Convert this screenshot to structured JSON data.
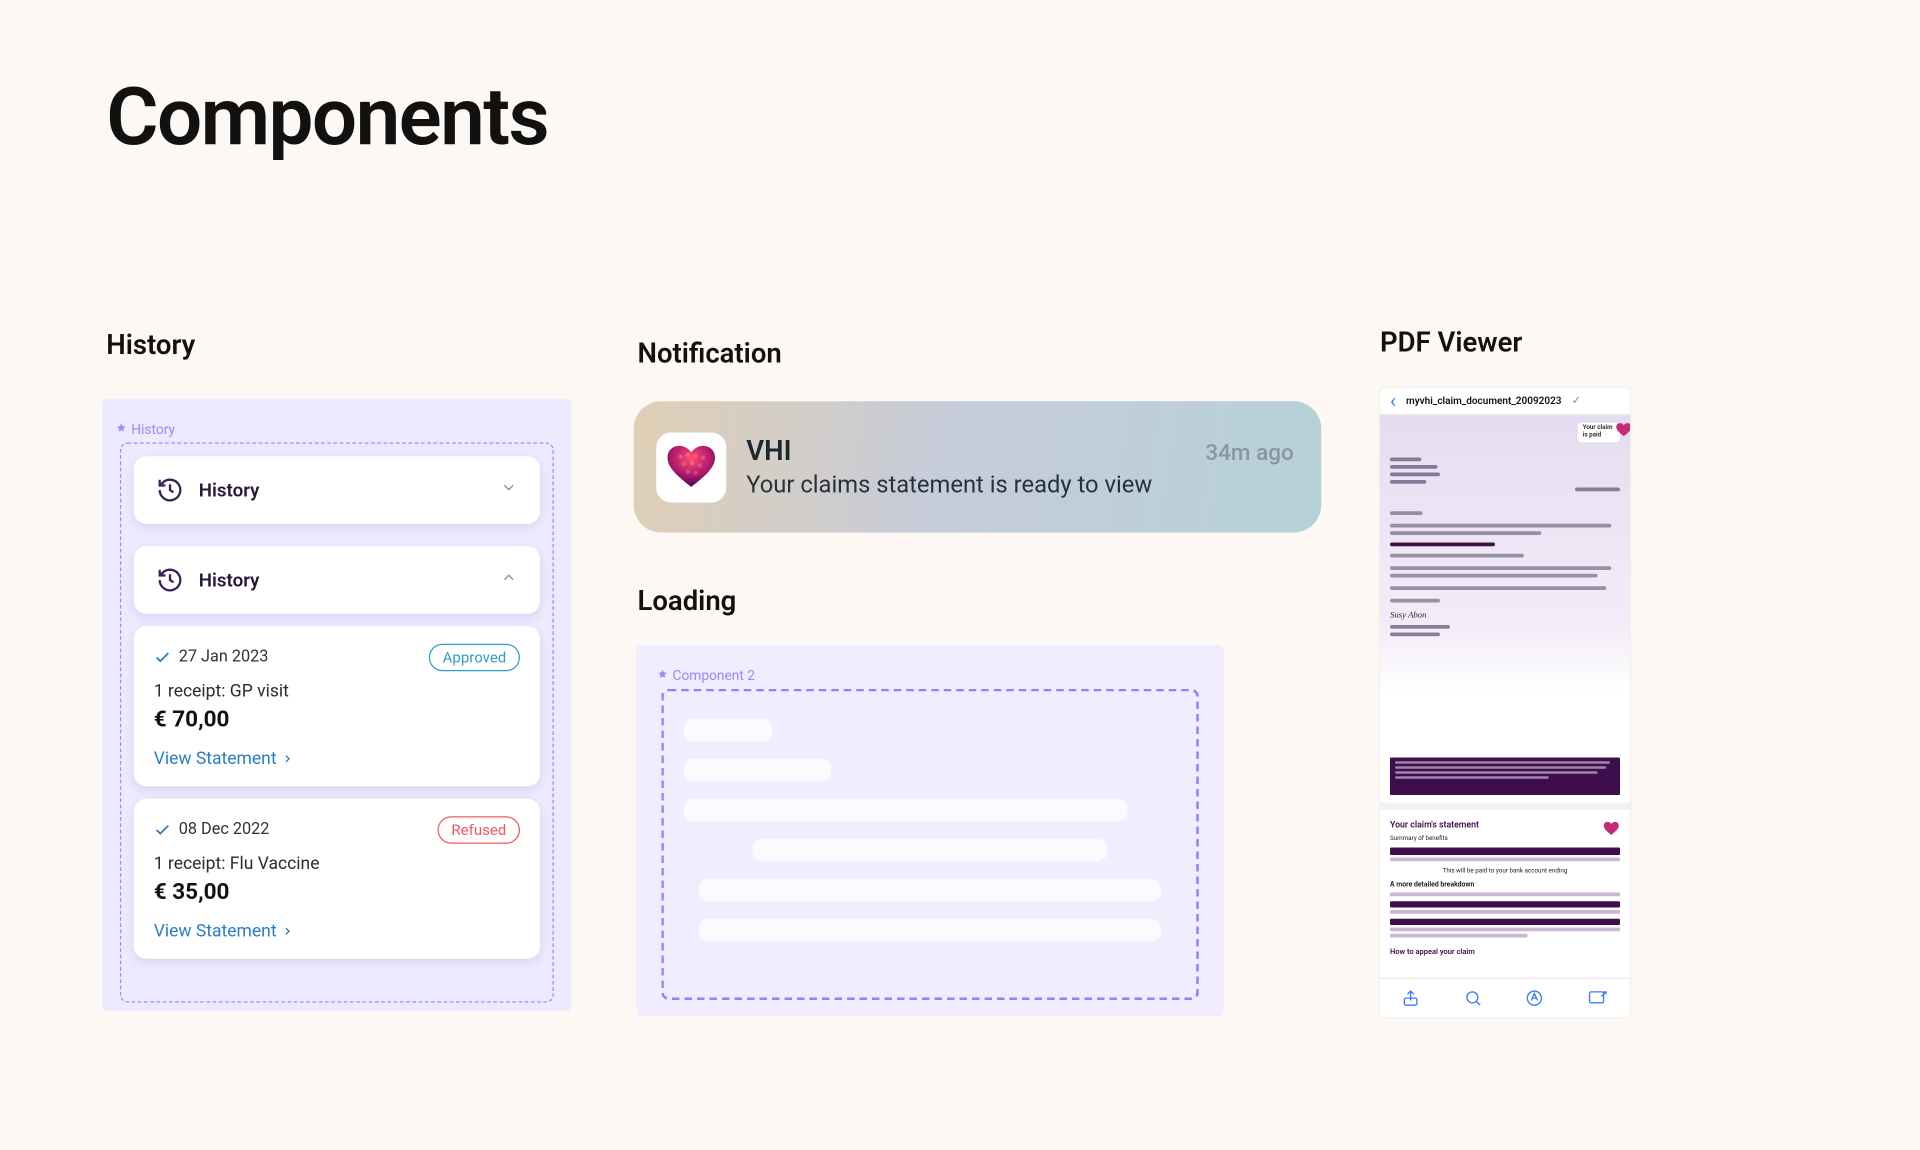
{
  "title": "Components",
  "sections": {
    "history": "History",
    "notification": "Notification",
    "loading": "Loading",
    "pdf": "PDF Viewer"
  },
  "figma": {
    "historyTag": "History",
    "loadingTag": "Component 2"
  },
  "history": {
    "heading": "History",
    "items": [
      {
        "date": "27 Jan 2023",
        "status": "Approved",
        "statusKind": "approved",
        "desc": "1 receipt: GP visit",
        "amount": "€ 70,00",
        "cta": "View Statement"
      },
      {
        "date": "08 Dec 2022",
        "status": "Refused",
        "statusKind": "refused",
        "desc": "1 receipt: Flu Vaccine",
        "amount": "€ 35,00",
        "cta": "View Statement"
      }
    ]
  },
  "notification": {
    "app": "VHI",
    "time": "34m ago",
    "body": "Your claims statement is ready to view"
  },
  "pdf": {
    "filename": "myvhi_claim_document_20092023",
    "paidLine1": "Your claim",
    "paidLine2": "is paid",
    "statementTitle": "Your claim's statement",
    "midNote": "This will be paid to your bank account ending",
    "breakdown": "A more detailed breakdown",
    "appeal": "How to appeal your claim",
    "signature": "Susy Abon"
  }
}
